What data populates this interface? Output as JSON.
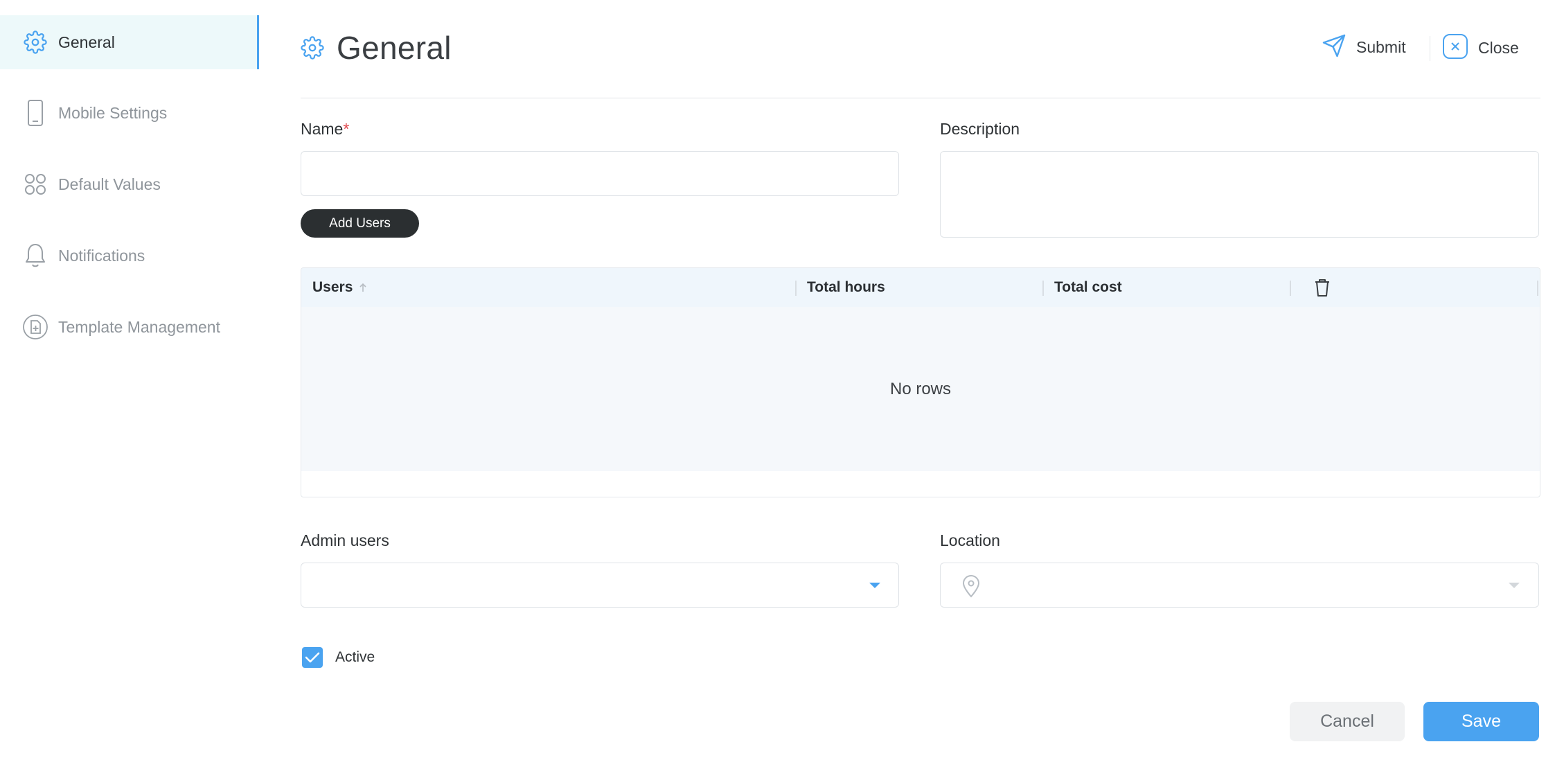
{
  "sidebar": {
    "items": [
      {
        "label": "General",
        "icon": "gear-icon",
        "active": true
      },
      {
        "label": "Mobile Settings",
        "icon": "mobile-icon",
        "active": false
      },
      {
        "label": "Default Values",
        "icon": "grid-dots-icon",
        "active": false
      },
      {
        "label": "Notifications",
        "icon": "bell-icon",
        "active": false
      },
      {
        "label": "Template Management",
        "icon": "template-add-icon",
        "active": false
      }
    ]
  },
  "header": {
    "title": "General",
    "submit_label": "Submit",
    "close_label": "Close"
  },
  "form": {
    "name_label": "Name",
    "required_mark": "*",
    "name_value": "",
    "description_label": "Description",
    "description_value": "",
    "add_users_label": "Add Users",
    "admin_users_label": "Admin users",
    "admin_users_value": "",
    "location_label": "Location",
    "location_value": "",
    "active_label": "Active",
    "active_checked": true
  },
  "users_table": {
    "columns": [
      "Users",
      "Total hours",
      "Total cost"
    ],
    "sort_column": "Users",
    "sort_direction": "ascending",
    "rows": [],
    "empty_text": "No rows"
  },
  "footer": {
    "cancel_label": "Cancel",
    "save_label": "Save"
  },
  "colors": {
    "accent": "#4aa3f0",
    "active_bg": "#edf9fa",
    "dark_button": "#2b2f31",
    "required": "#e0484e"
  }
}
